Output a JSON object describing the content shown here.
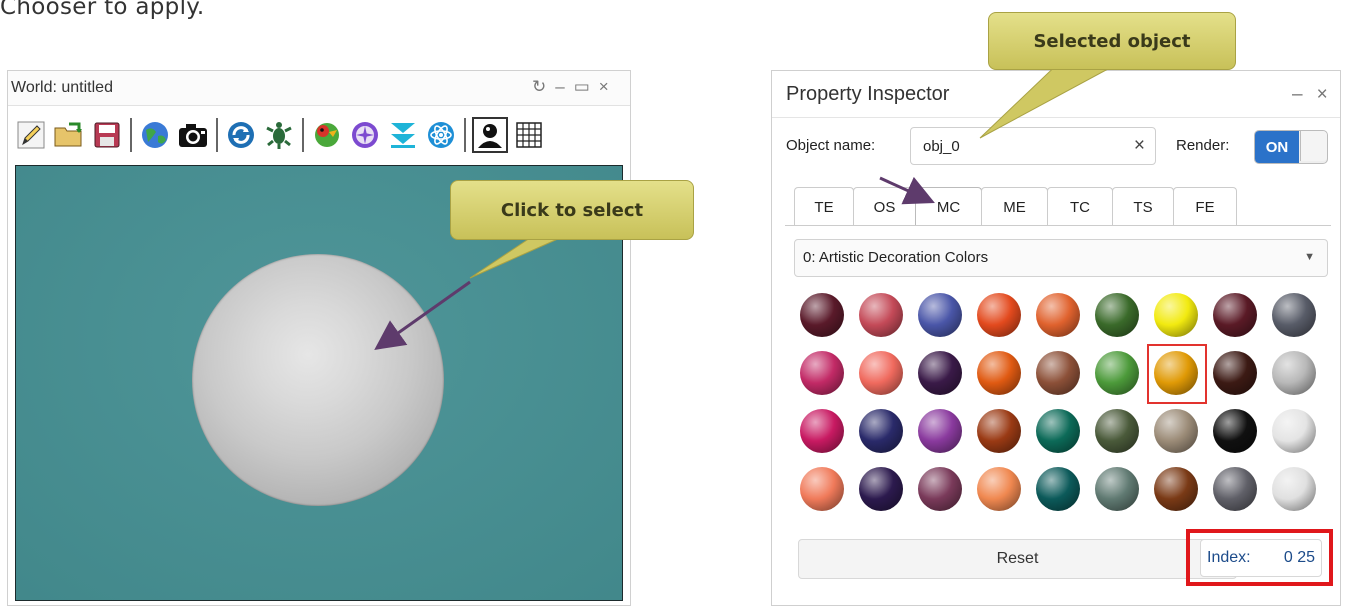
{
  "intro_text": "Chooser to apply.",
  "world": {
    "title": "World: untitled",
    "controls": [
      "↻",
      "–",
      "▭",
      "×"
    ],
    "toolbar_icons": [
      "pencil-icon",
      "open-folder-icon",
      "save-icon",
      "globe-icon",
      "camera-icon",
      "refresh-icon",
      "turtle-icon",
      "parrot-icon",
      "compass-icon",
      "collapse-icon",
      "atom-icon",
      "avatar-icon",
      "grid-icon"
    ]
  },
  "inspector": {
    "title": "Property Inspector",
    "controls": [
      "–",
      "×"
    ],
    "object_name_label": "Object name:",
    "object_name_value": "obj_0",
    "clear_glyph": "×",
    "render_label": "Render:",
    "render_state": "ON",
    "tabs": [
      "TE",
      "OS",
      "MC",
      "ME",
      "TC",
      "TS",
      "FE"
    ],
    "active_tab": "MC",
    "material_set": "0: Artistic Decoration Colors",
    "selected_swatch_index": 15,
    "swatches": [
      "#5a1a2a",
      "#c44a58",
      "#4a56a8",
      "#e34a1e",
      "#e0622e",
      "#3a6a2a",
      "#f2ea10",
      "#5a1a26",
      "#585c68",
      "#c22a66",
      "#f06a5e",
      "#3a1a48",
      "#e05a12",
      "#8c5038",
      "#4c9a3a",
      "#e09a06",
      "#3c1a14",
      "#b8b8b8",
      "#c81a62",
      "#2a2a6a",
      "#8a3a9e",
      "#9a3a14",
      "#0c6a58",
      "#4a5a3a",
      "#9c8c78",
      "#101010",
      "#e4e4e4",
      "#f07a5a",
      "#2c1a4e",
      "#7a3a5a",
      "#f08850",
      "#0c5a5a",
      "#607a72",
      "#7a3a16",
      "#606068",
      "#e0e0e0"
    ],
    "reset_label": "Reset",
    "index_label": "Index:",
    "index_value": "0 25"
  },
  "callouts": {
    "selected_object": "Selected object",
    "click_to_select": "Click to select"
  },
  "colors": {
    "accent_blue": "#2b72c9",
    "highlight_red": "#e0171b",
    "callout_fill": "#d6d06a",
    "arrow_purple": "#5e3b6c",
    "viewport_teal": "#458b8e"
  }
}
